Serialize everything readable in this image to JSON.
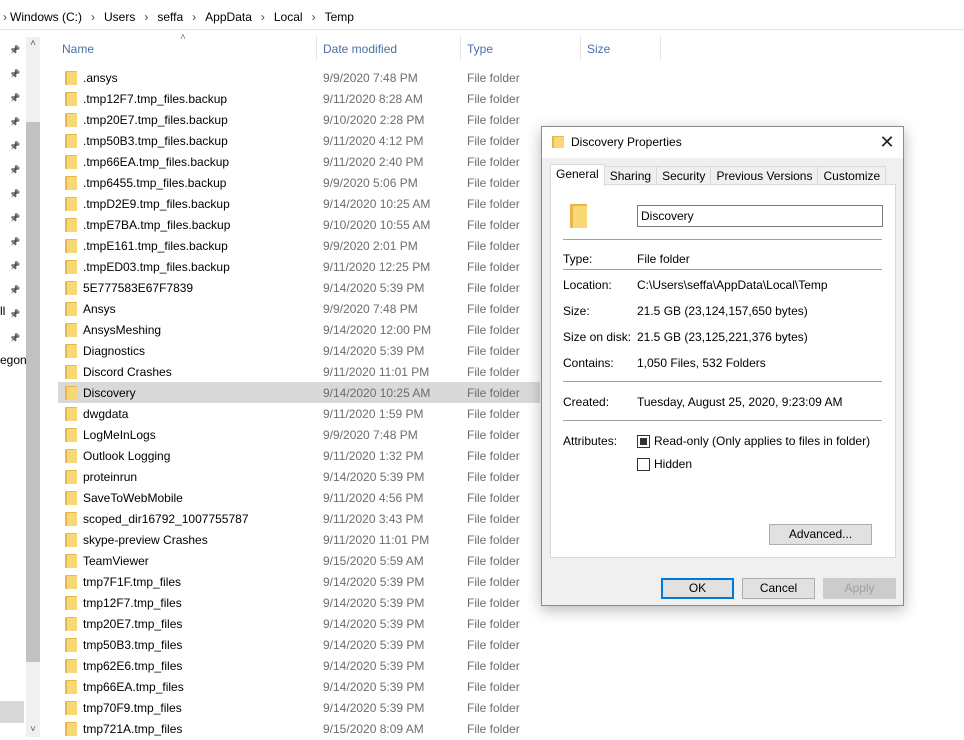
{
  "breadcrumb": [
    "Windows (C:)",
    "Users",
    "seffa",
    "AppData",
    "Local",
    "Temp"
  ],
  "left_pane": {
    "pins": 13,
    "partial_labels": [
      "ll",
      "egon"
    ]
  },
  "columns": {
    "name": "Name",
    "date": "Date modified",
    "type": "Type",
    "size": "Size"
  },
  "files": [
    {
      "name": ".ansys",
      "date": "9/9/2020 7:48 PM",
      "type": "File folder"
    },
    {
      "name": ".tmp12F7.tmp_files.backup",
      "date": "9/11/2020 8:28 AM",
      "type": "File folder"
    },
    {
      "name": ".tmp20E7.tmp_files.backup",
      "date": "9/10/2020 2:28 PM",
      "type": "File folder"
    },
    {
      "name": ".tmp50B3.tmp_files.backup",
      "date": "9/11/2020 4:12 PM",
      "type": "File folder"
    },
    {
      "name": ".tmp66EA.tmp_files.backup",
      "date": "9/11/2020 2:40 PM",
      "type": "File folder"
    },
    {
      "name": ".tmp6455.tmp_files.backup",
      "date": "9/9/2020 5:06 PM",
      "type": "File folder"
    },
    {
      "name": ".tmpD2E9.tmp_files.backup",
      "date": "9/14/2020 10:25 AM",
      "type": "File folder"
    },
    {
      "name": ".tmpE7BA.tmp_files.backup",
      "date": "9/10/2020 10:55 AM",
      "type": "File folder"
    },
    {
      "name": ".tmpE161.tmp_files.backup",
      "date": "9/9/2020 2:01 PM",
      "type": "File folder"
    },
    {
      "name": ".tmpED03.tmp_files.backup",
      "date": "9/11/2020 12:25 PM",
      "type": "File folder"
    },
    {
      "name": "5E777583E67F7839",
      "date": "9/14/2020 5:39 PM",
      "type": "File folder"
    },
    {
      "name": "Ansys",
      "date": "9/9/2020 7:48 PM",
      "type": "File folder"
    },
    {
      "name": "AnsysMeshing",
      "date": "9/14/2020 12:00 PM",
      "type": "File folder"
    },
    {
      "name": "Diagnostics",
      "date": "9/14/2020 5:39 PM",
      "type": "File folder"
    },
    {
      "name": "Discord Crashes",
      "date": "9/11/2020 11:01 PM",
      "type": "File folder"
    },
    {
      "name": "Discovery",
      "date": "9/14/2020 10:25 AM",
      "type": "File folder",
      "selected": true
    },
    {
      "name": "dwgdata",
      "date": "9/11/2020 1:59 PM",
      "type": "File folder"
    },
    {
      "name": "LogMeInLogs",
      "date": "9/9/2020 7:48 PM",
      "type": "File folder"
    },
    {
      "name": "Outlook Logging",
      "date": "9/11/2020 1:32 PM",
      "type": "File folder"
    },
    {
      "name": "proteinrun",
      "date": "9/14/2020 5:39 PM",
      "type": "File folder"
    },
    {
      "name": "SaveToWebMobile",
      "date": "9/11/2020 4:56 PM",
      "type": "File folder"
    },
    {
      "name": "scoped_dir16792_1007755787",
      "date": "9/11/2020 3:43 PM",
      "type": "File folder"
    },
    {
      "name": "skype-preview Crashes",
      "date": "9/11/2020 11:01 PM",
      "type": "File folder"
    },
    {
      "name": "TeamViewer",
      "date": "9/15/2020 5:59 AM",
      "type": "File folder"
    },
    {
      "name": "tmp7F1F.tmp_files",
      "date": "9/14/2020 5:39 PM",
      "type": "File folder"
    },
    {
      "name": "tmp12F7.tmp_files",
      "date": "9/14/2020 5:39 PM",
      "type": "File folder"
    },
    {
      "name": "tmp20E7.tmp_files",
      "date": "9/14/2020 5:39 PM",
      "type": "File folder"
    },
    {
      "name": "tmp50B3.tmp_files",
      "date": "9/14/2020 5:39 PM",
      "type": "File folder"
    },
    {
      "name": "tmp62E6.tmp_files",
      "date": "9/14/2020 5:39 PM",
      "type": "File folder"
    },
    {
      "name": "tmp66EA.tmp_files",
      "date": "9/14/2020 5:39 PM",
      "type": "File folder"
    },
    {
      "name": "tmp70F9.tmp_files",
      "date": "9/14/2020 5:39 PM",
      "type": "File folder"
    },
    {
      "name": "tmp721A.tmp_files",
      "date": "9/15/2020 8:09 AM",
      "type": "File folder"
    }
  ],
  "dialog": {
    "title": "Discovery Properties",
    "close_glyph": "✕",
    "tabs": [
      "General",
      "Sharing",
      "Security",
      "Previous Versions",
      "Customize"
    ],
    "active_tab": "General",
    "folder_name": "Discovery",
    "type_label": "Type:",
    "type_value": "File folder",
    "location_label": "Location:",
    "location_value": "C:\\Users\\seffa\\AppData\\Local\\Temp",
    "size_label": "Size:",
    "size_value": "21.5 GB (23,124,157,650 bytes)",
    "size_on_disk_label": "Size on disk:",
    "size_on_disk_value": "21.5 GB (23,125,221,376 bytes)",
    "contains_label": "Contains:",
    "contains_value": "1,050 Files, 532 Folders",
    "created_label": "Created:",
    "created_value": "Tuesday, August 25, 2020, 9:23:09 AM",
    "attributes_label": "Attributes:",
    "readonly_label": "Read-only (Only applies to files in folder)",
    "readonly_checked": true,
    "hidden_label": "Hidden",
    "hidden_checked": false,
    "advanced_label": "Advanced...",
    "ok_label": "OK",
    "cancel_label": "Cancel",
    "apply_label": "Apply"
  },
  "colors": {
    "selection": "#d9d9d9",
    "folder_yellow": "#f8d775",
    "header_text": "#4a6fa5",
    "default_button_border": "#0078d7"
  }
}
